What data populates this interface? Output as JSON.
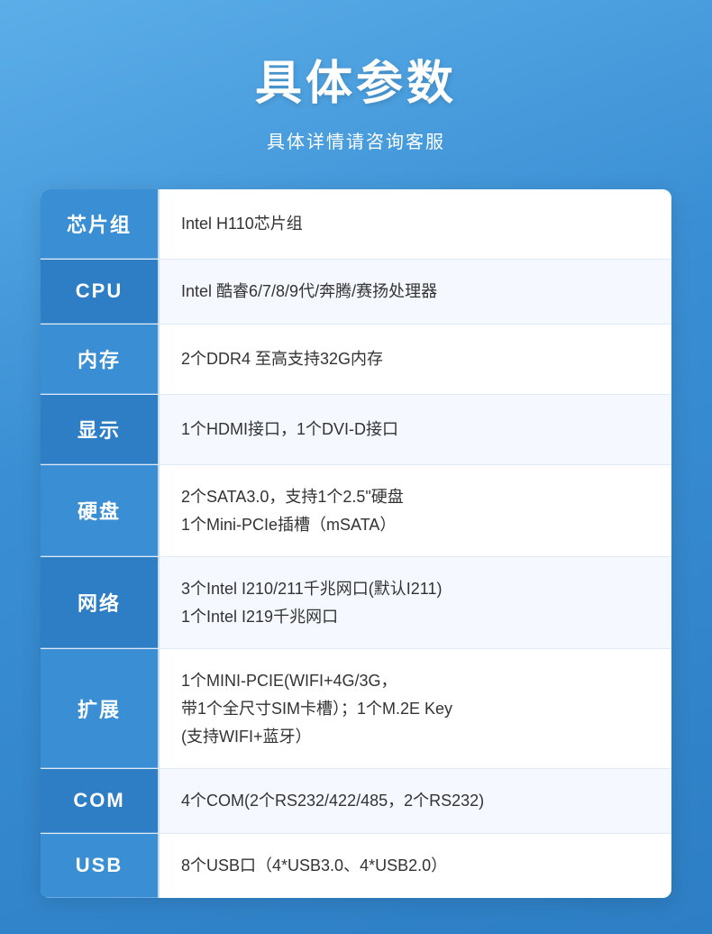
{
  "header": {
    "title": "具体参数",
    "subtitle": "具体详情请咨询客服"
  },
  "table": {
    "rows": [
      {
        "label": "芯片组",
        "value": "Intel H110芯片组"
      },
      {
        "label": "CPU",
        "value": "Intel 酷睿6/7/8/9代/奔腾/赛扬处理器"
      },
      {
        "label": "内存",
        "value": "2个DDR4 至高支持32G内存"
      },
      {
        "label": "显示",
        "value": "1个HDMI接口，1个DVI-D接口"
      },
      {
        "label": "硬盘",
        "value": "2个SATA3.0，支持1个2.5\"硬盘\n1个Mini-PCIe插槽（mSATA）"
      },
      {
        "label": "网络",
        "value": "3个Intel I210/211千兆网口(默认I211)\n1个Intel I219千兆网口"
      },
      {
        "label": "扩展",
        "value": "1个MINI-PCIE(WIFI+4G/3G，\n带1个全尺寸SIM卡槽）；1个M.2E Key\n(支持WIFI+蓝牙）"
      },
      {
        "label": "COM",
        "value": "4个COM(2个RS232/422/485，2个RS232)"
      },
      {
        "label": "USB",
        "value": "8个USB口（4*USB3.0、4*USB2.0）"
      }
    ]
  }
}
